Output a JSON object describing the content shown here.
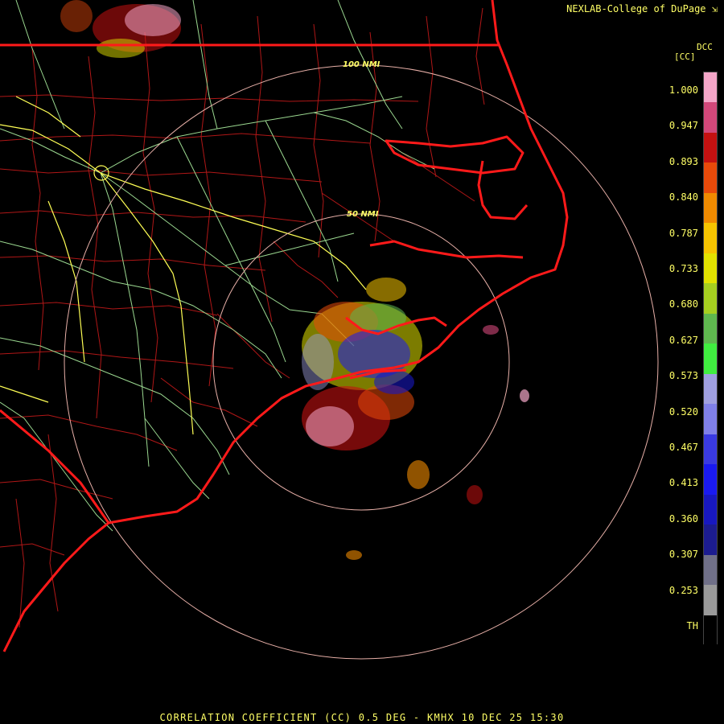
{
  "header": {
    "credit": "NEXLAB-College of DuPage",
    "credit_icon": "nexlab-logo-icon"
  },
  "legend": {
    "product_code": "DCC",
    "unit": "[CC]",
    "labels": [
      "1.000",
      "0.947",
      "0.893",
      "0.840",
      "0.787",
      "0.733",
      "0.680",
      "0.627",
      "0.573",
      "0.520",
      "0.467",
      "0.413",
      "0.360",
      "0.307",
      "0.253",
      "TH"
    ],
    "colors": [
      "#f4a6c8",
      "#d2487a",
      "#c41111",
      "#e84a0a",
      "#f08a00",
      "#f6c400",
      "#e2e200",
      "#a6cf20",
      "#5fb84f",
      "#40ee40",
      "#a0a0e0",
      "#8080e8",
      "#3a3ae0",
      "#1a1af0",
      "#1818c0",
      "#1c1c90",
      "#707088",
      "#9a9a9a",
      "#000000"
    ]
  },
  "range_rings": {
    "inner_label": "50 NMI",
    "outer_label": "100 NMI"
  },
  "footer": {
    "caption": "CORRELATION COEFFICIENT (CC) 0.5 DEG - KMHX 10 DEC 25 15:30"
  },
  "colors": {
    "state_border": "#ff1a1a",
    "county_border": "#c41a1a",
    "highway_interstate": "#ffff55",
    "highway_secondary": "#9bd890",
    "range_ring": "#e8b0a8",
    "text": "#ffff66"
  }
}
